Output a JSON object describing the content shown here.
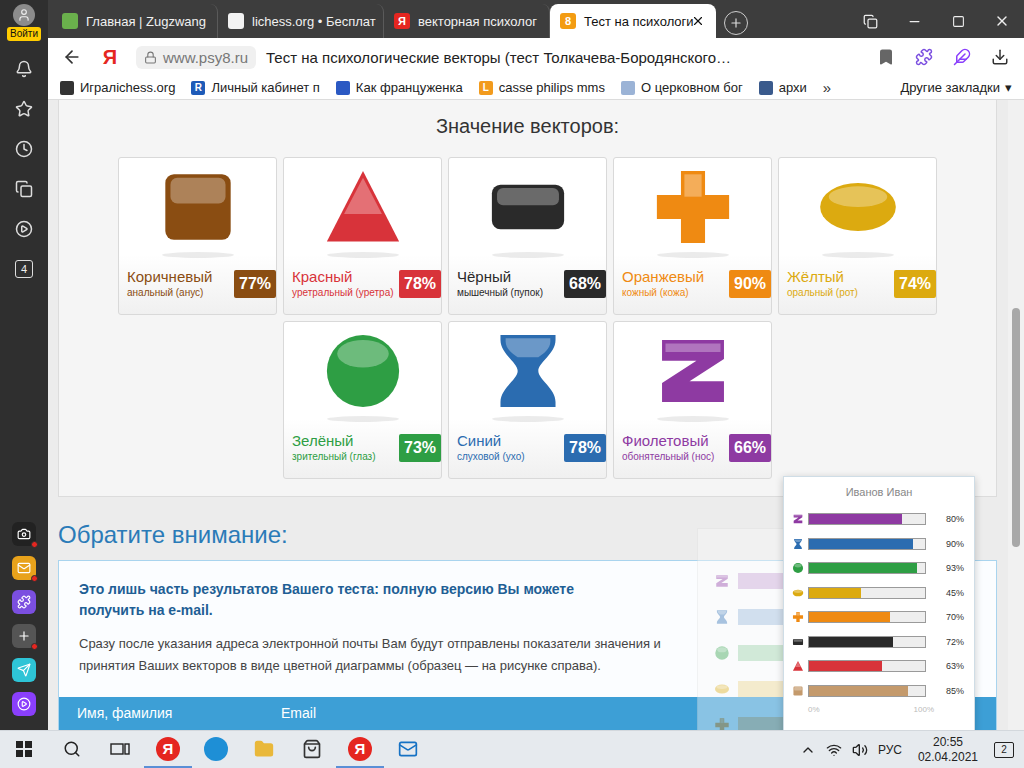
{
  "sidebar": {
    "login": "Войти",
    "badge": "4",
    "apps": [
      {
        "kind": "camera",
        "color": "#222222",
        "badge": true
      },
      {
        "kind": "mail",
        "color": "#e8a21b",
        "badge": true
      },
      {
        "kind": "puzzle",
        "color": "#7b4fe0",
        "badge": false
      },
      {
        "kind": "plus",
        "color": "#555555",
        "badge": true
      },
      {
        "kind": "send",
        "color": "#2ec4d6",
        "badge": false
      },
      {
        "kind": "alice",
        "color": "#8a3ffc",
        "badge": false
      }
    ]
  },
  "tabs": [
    {
      "label": "Главная | Zugzwang",
      "selected": false,
      "color": "#6ab04c"
    },
    {
      "label": "lichess.org • Бесплат",
      "selected": false,
      "color": "#f2f2f2"
    },
    {
      "label": "векторная психолог",
      "selected": false,
      "favicon": "Я",
      "color": "#e52620"
    },
    {
      "label": "Тест на психологи",
      "selected": true,
      "favicon": "8",
      "color": "#f39c12"
    }
  ],
  "address": {
    "brand": "Я",
    "domain": "www.psy8.ru",
    "title": "Тест на психологические векторы (тест Толкачева-Бородянского…"
  },
  "bookmarks": {
    "items": [
      {
        "label": "Игралichess.org",
        "color": "#333333"
      },
      {
        "label": "Личный кабинет п",
        "glyph": "R",
        "color": "#1e5bb8"
      },
      {
        "label": "Как француженка",
        "color": "#2b59c3"
      },
      {
        "label": "casse philips mms",
        "glyph": "L",
        "color": "#f29b1d"
      },
      {
        "label": "О церковном бог",
        "color": "#9bb3d6"
      },
      {
        "label": "архи",
        "color": "#3a5a8c"
      }
    ],
    "more": "»",
    "other": "Другие закладки",
    "other_arrow": "▾"
  },
  "vectors": {
    "title": "Значение векторов:",
    "items": [
      {
        "name": "Коричневый",
        "organ": "анальный (анус)",
        "value": "77%",
        "kind": "square",
        "color": "#8a4d12"
      },
      {
        "name": "Красный",
        "organ": "уретральный (уретра)",
        "value": "78%",
        "kind": "triangle",
        "color": "#d8333a"
      },
      {
        "name": "Чёрный",
        "organ": "мышечный (пупок)",
        "value": "68%",
        "kind": "bar",
        "color": "#2a2a2a"
      },
      {
        "name": "Оранжевый",
        "organ": "кожный (кожа)",
        "value": "90%",
        "kind": "cross",
        "color": "#ef8a12"
      },
      {
        "name": "Жёлтый",
        "organ": "оральный (рот)",
        "value": "74%",
        "kind": "oval",
        "color": "#dcaa10"
      },
      {
        "name": "Зелёный",
        "organ": "зрительный (глаз)",
        "value": "73%",
        "kind": "circle",
        "color": "#2e9e44"
      },
      {
        "name": "Синий",
        "organ": "слуховой (ухо)",
        "value": "78%",
        "kind": "hourglass",
        "color": "#2b6cb0"
      },
      {
        "name": "Фиолетовый",
        "organ": "обонятельный (нос)",
        "value": "66%",
        "kind": "zigzag",
        "color": "#8e3aa2"
      }
    ]
  },
  "notice": {
    "title": "Обратите внимание:",
    "lead": "Это лишь часть результатов Вашего теста: полную версию Вы можете получить на e-mail.",
    "text": "Сразу после указания адреса электронной почты Вам будут отправлены показатели значения и принятия Ваших векторов в виде цветной диаграммы (образец — на рисунке справа).",
    "fields": [
      "Имя, фамилия",
      "Email"
    ]
  },
  "sample_chart": {
    "title": "Иванов Иван",
    "ticks": [
      "0%",
      "100%"
    ],
    "rows": [
      {
        "kind": "zigzag",
        "color": "#8e3aa2",
        "value": 80,
        "label": "80%"
      },
      {
        "kind": "hourglass",
        "color": "#2b6cb0",
        "value": 90,
        "label": "90%"
      },
      {
        "kind": "circle",
        "color": "#2e9e44",
        "value": 93,
        "label": "93%"
      },
      {
        "kind": "oval",
        "color": "#dcaa10",
        "value": 45,
        "label": "45%"
      },
      {
        "kind": "cross",
        "color": "#ef8a12",
        "value": 70,
        "label": "70%"
      },
      {
        "kind": "bar",
        "color": "#2a2a2a",
        "value": 72,
        "label": "72%"
      },
      {
        "kind": "triangle",
        "color": "#d8333a",
        "value": 63,
        "label": "63%"
      },
      {
        "kind": "square",
        "color": "#c49a6c",
        "value": 85,
        "label": "85%"
      }
    ]
  },
  "scrollbar": {
    "offset": 0.33,
    "size": 0.38
  },
  "taskbar": {
    "apps": [
      {
        "kind": "yandex",
        "glyph": "Я",
        "color": "#e52620",
        "running": true
      },
      {
        "kind": "edge",
        "color": "#1e8fd6",
        "running": false
      },
      {
        "kind": "folder",
        "color": "#e9b83a",
        "running": false
      },
      {
        "kind": "store",
        "color": "#333333",
        "running": false
      },
      {
        "kind": "yandex-browser",
        "glyph": "Я",
        "color": "#e52620",
        "running": true
      },
      {
        "kind": "mail",
        "color": "#1672c4",
        "running": false
      }
    ],
    "lang": "РУС",
    "time": "20:55",
    "date": "02.04.2021",
    "notifications": "2"
  }
}
